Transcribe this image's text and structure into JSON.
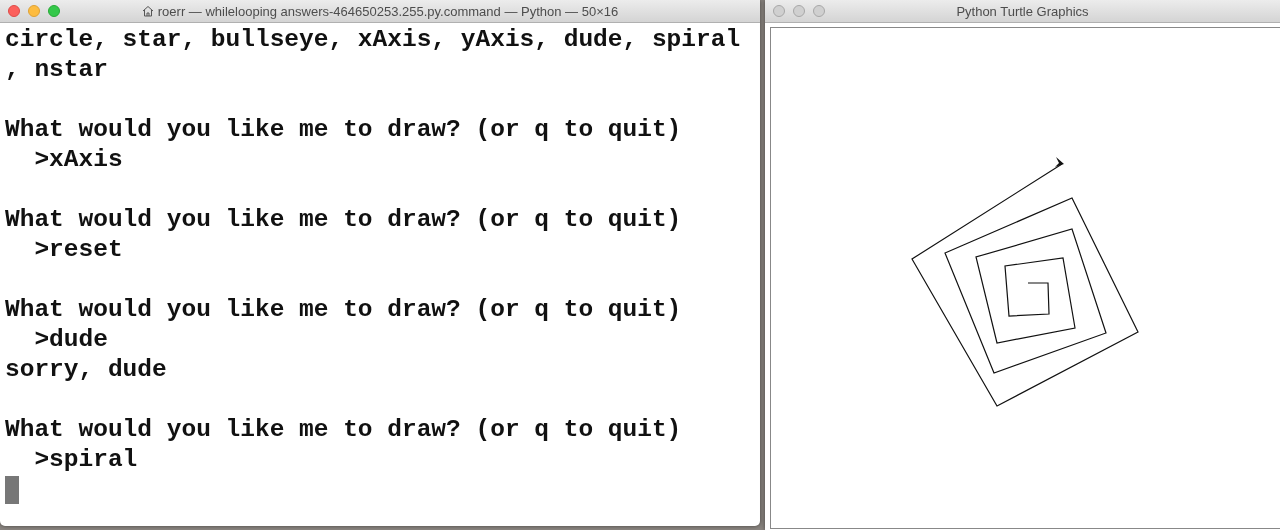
{
  "terminal": {
    "title": "roerr — whilelooping answers-464650253.255.py.command — Python — 50×16",
    "active": true,
    "paragraphs": [
      [
        "circle, star, bullseye, xAxis, yAxis, dude, spiral",
        ", nstar"
      ],
      [
        "What would you like me to draw? (or q to quit)",
        "  >xAxis"
      ],
      [
        "What would you like me to draw? (or q to quit)",
        "  >reset"
      ],
      [
        "What would you like me to draw? (or q to quit)",
        "  >dude",
        "sorry, dude"
      ],
      [
        "What would you like me to draw? (or q to quit)",
        "  >spiral"
      ]
    ],
    "cursor": true
  },
  "turtle": {
    "title": "Python Turtle Graphics",
    "active": false
  }
}
